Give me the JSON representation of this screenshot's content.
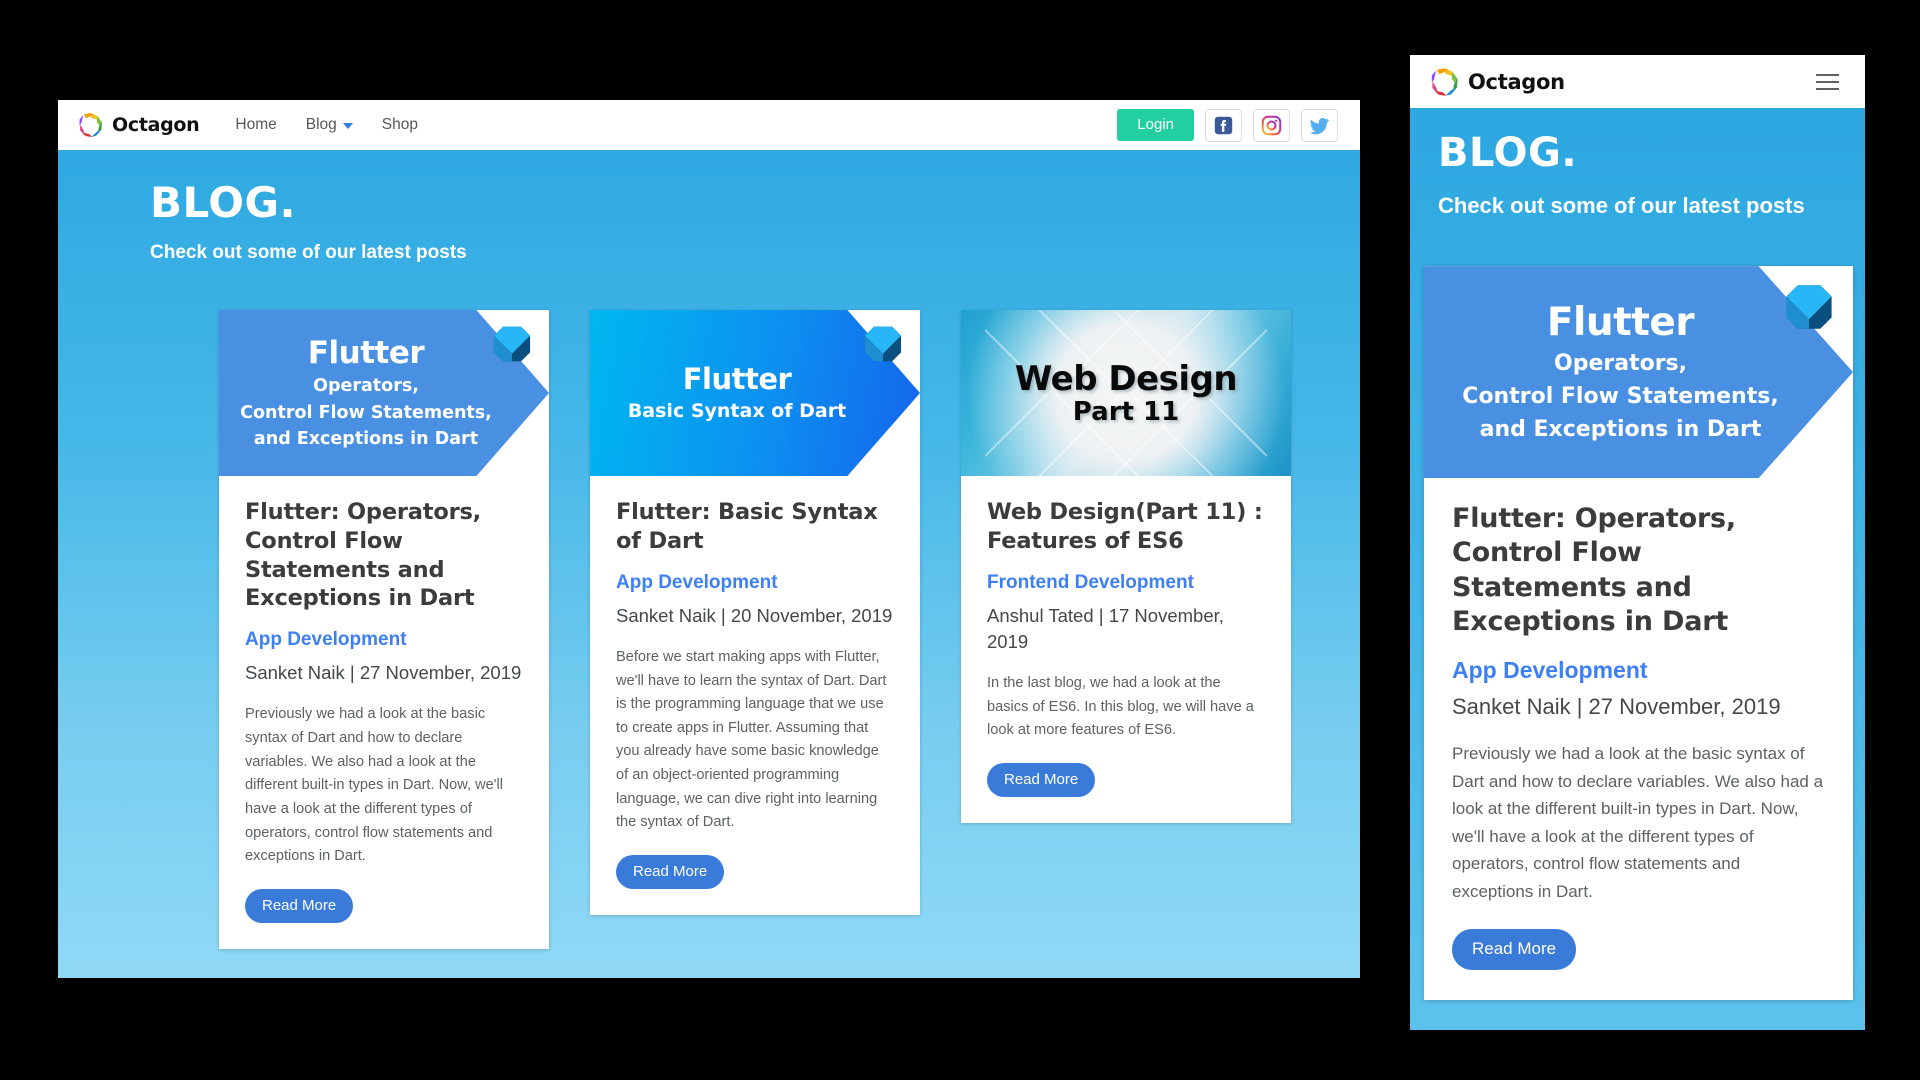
{
  "navbar": {
    "brand": "Octagon",
    "logo_icon": "octagon-logo",
    "links": [
      {
        "label": "Home",
        "has_caret": false
      },
      {
        "label": "Blog",
        "has_caret": true
      },
      {
        "label": "Shop",
        "has_caret": false
      }
    ],
    "login_label": "Login",
    "login_color": "#23cfa0",
    "social": [
      {
        "name": "facebook-icon"
      },
      {
        "name": "instagram-icon"
      },
      {
        "name": "twitter-icon"
      }
    ],
    "hamburger_icon": "hamburger-menu-icon"
  },
  "hero": {
    "title": "BLOG.",
    "subtitle": "Check out some of our latest posts"
  },
  "theme": {
    "page_bg_top": "#2ba6e0",
    "page_bg_bottom": "#8fd9f6",
    "category_link": "#3d7ff5",
    "read_more_bg": "#3a7bd9"
  },
  "cards": [
    {
      "banner": {
        "style": "flutter-blue",
        "main": "Flutter",
        "sub_lines": [
          "Operators,",
          "Control Flow Statements,",
          "and Exceptions in Dart"
        ],
        "logo_icon": "dart-logo"
      },
      "title": "Flutter: Operators, Control Flow Statements and Exceptions in Dart",
      "category": "App Development",
      "meta": "Sanket Naik | 27 November, 2019",
      "excerpt": "Previously we had a look at the basic syntax of Dart and how to declare variables. We also had a look at the different built-in types in Dart. Now, we'll have a look at the different types of operators, control flow statements and exceptions in Dart.",
      "read_more": "Read More"
    },
    {
      "banner": {
        "style": "flutter-cyan-gradient",
        "main": "Flutter",
        "sub_lines": [
          "Basic Syntax of Dart"
        ],
        "logo_icon": "dart-logo"
      },
      "title": "Flutter: Basic Syntax of Dart",
      "category": "App Development",
      "meta": "Sanket Naik | 20 November, 2019",
      "excerpt": "Before we start making apps with Flutter, we'll have to learn the syntax of Dart. Dart is the programming language that we use to create apps in Flutter. Assuming that you already have some basic knowledge of an object-oriented programming language, we can dive right into learning the syntax of Dart.",
      "read_more": "Read More"
    },
    {
      "banner": {
        "style": "web-design-chevrons",
        "main": "Web Design",
        "sub_lines": [
          "Part 11"
        ],
        "logo_icon": null
      },
      "title": "Web Design(Part 11) : Features of ES6",
      "category": "Frontend Development",
      "meta": "Anshul Tated | 17 November, 2019",
      "excerpt": "In the last blog, we had a look at the basics of ES6. In this blog, we will have a look at more features of ES6.",
      "read_more": "Read More"
    }
  ],
  "mobile": {
    "hero": {
      "title": "BLOG.",
      "subtitle": "Check out some of our latest posts"
    },
    "card": {
      "banner": {
        "main": "Flutter",
        "sub_lines": [
          "Operators,",
          "Control Flow Statements,",
          "and Exceptions in Dart"
        ],
        "logo_icon": "dart-logo"
      },
      "title": "Flutter: Operators, Control Flow Statements and Exceptions in Dart",
      "category": "App Development",
      "meta": "Sanket Naik | 27 November, 2019",
      "excerpt": "Previously we had a look at the basic syntax of Dart and how to declare variables. We also had a look at the different built-in types in Dart. Now, we'll have a look at the different types of operators, control flow statements and exceptions in Dart.",
      "read_more": "Read More"
    }
  }
}
